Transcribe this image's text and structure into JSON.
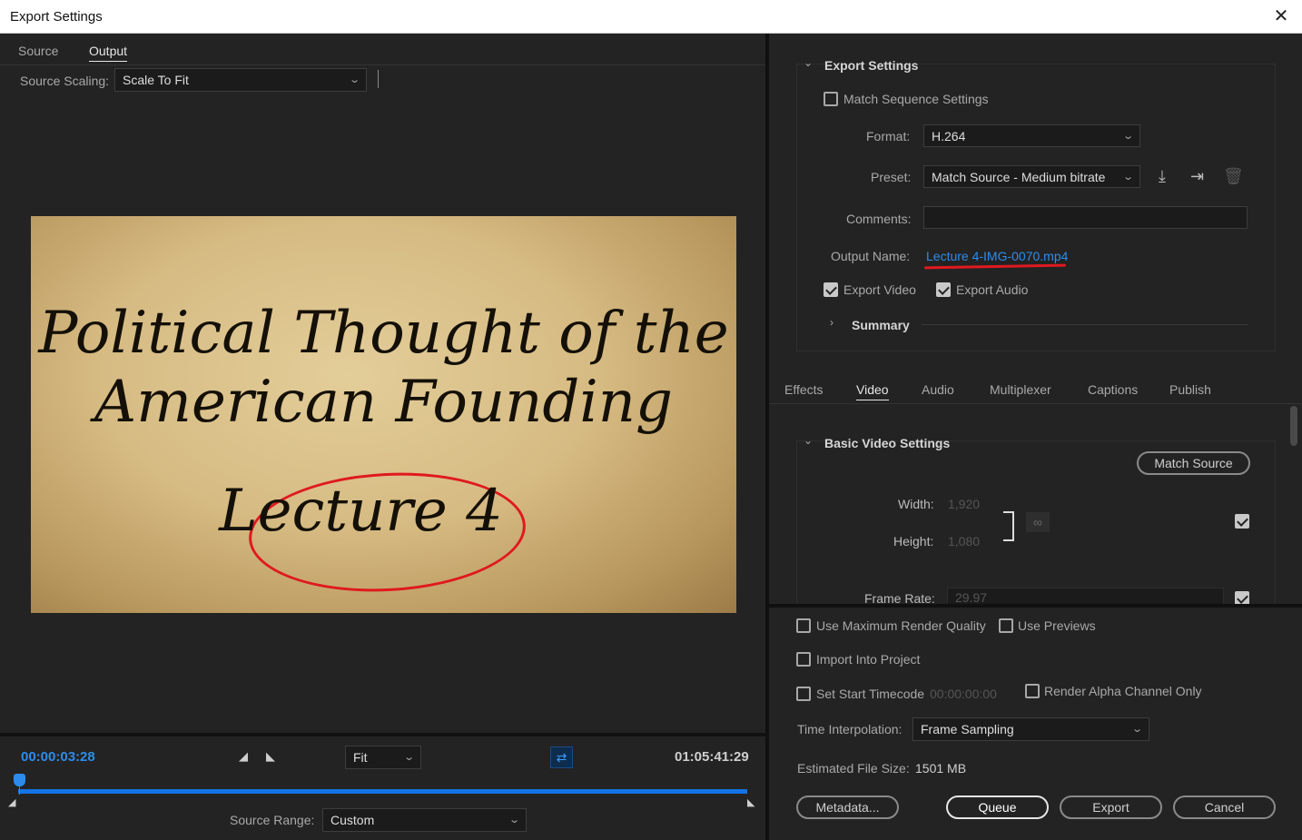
{
  "window": {
    "title": "Export Settings",
    "close_label": "✕"
  },
  "left": {
    "tabs": [
      {
        "label": "Source"
      },
      {
        "label": "Output"
      }
    ],
    "source_scaling": {
      "label": "Source Scaling:",
      "value": "Scale To Fit"
    },
    "preview": {
      "title_line1": "Political Thought of the",
      "title_line2": "American Founding",
      "subtitle": "Lecture 4"
    },
    "timeline": {
      "current_time": "00:00:03:28",
      "duration": "01:05:41:29",
      "zoom": "Fit",
      "playhead_fraction": 0.0
    },
    "source_range": {
      "label": "Source Range:",
      "value": "Custom"
    }
  },
  "export_settings": {
    "section_title": "Export Settings",
    "match_sequence": {
      "label": "Match Sequence Settings",
      "checked": false
    },
    "format": {
      "label": "Format:",
      "value": "H.264"
    },
    "preset": {
      "label": "Preset:",
      "value": "Match Source - Medium bitrate"
    },
    "comments": {
      "label": "Comments:",
      "value": ""
    },
    "output_name": {
      "label": "Output Name:",
      "value": "Lecture 4-IMG-0070.mp4"
    },
    "export_video": {
      "label": "Export Video",
      "checked": true
    },
    "export_audio": {
      "label": "Export Audio",
      "checked": true
    },
    "summary": "Summary"
  },
  "tabs": [
    {
      "label": "Effects"
    },
    {
      "label": "Video"
    },
    {
      "label": "Audio"
    },
    {
      "label": "Multiplexer"
    },
    {
      "label": "Captions"
    },
    {
      "label": "Publish"
    }
  ],
  "video": {
    "section_title": "Basic Video Settings",
    "match_source": "Match Source",
    "width": {
      "label": "Width:",
      "value": "1,920"
    },
    "height": {
      "label": "Height:",
      "value": "1,080"
    },
    "frame_rate": {
      "label": "Frame Rate:",
      "value": "29.97"
    }
  },
  "bottom": {
    "max_render_quality": {
      "label": "Use Maximum Render Quality",
      "checked": false
    },
    "use_previews": {
      "label": "Use Previews",
      "checked": false
    },
    "import_into_project": {
      "label": "Import Into Project",
      "checked": false
    },
    "set_start_timecode": {
      "label": "Set Start Timecode",
      "checked": false,
      "value": "00:00:00:00"
    },
    "render_alpha": {
      "label": "Render Alpha Channel Only",
      "checked": false
    },
    "time_interpolation": {
      "label": "Time Interpolation:",
      "value": "Frame Sampling"
    },
    "file_size": {
      "label": "Estimated File Size:",
      "value": "1501 MB"
    },
    "buttons": {
      "metadata": "Metadata...",
      "queue": "Queue",
      "export": "Export",
      "cancel": "Cancel"
    }
  },
  "colors": {
    "accent": "#1473e6",
    "annotation_red": "#e0191e",
    "link": "#2d8ceb"
  }
}
